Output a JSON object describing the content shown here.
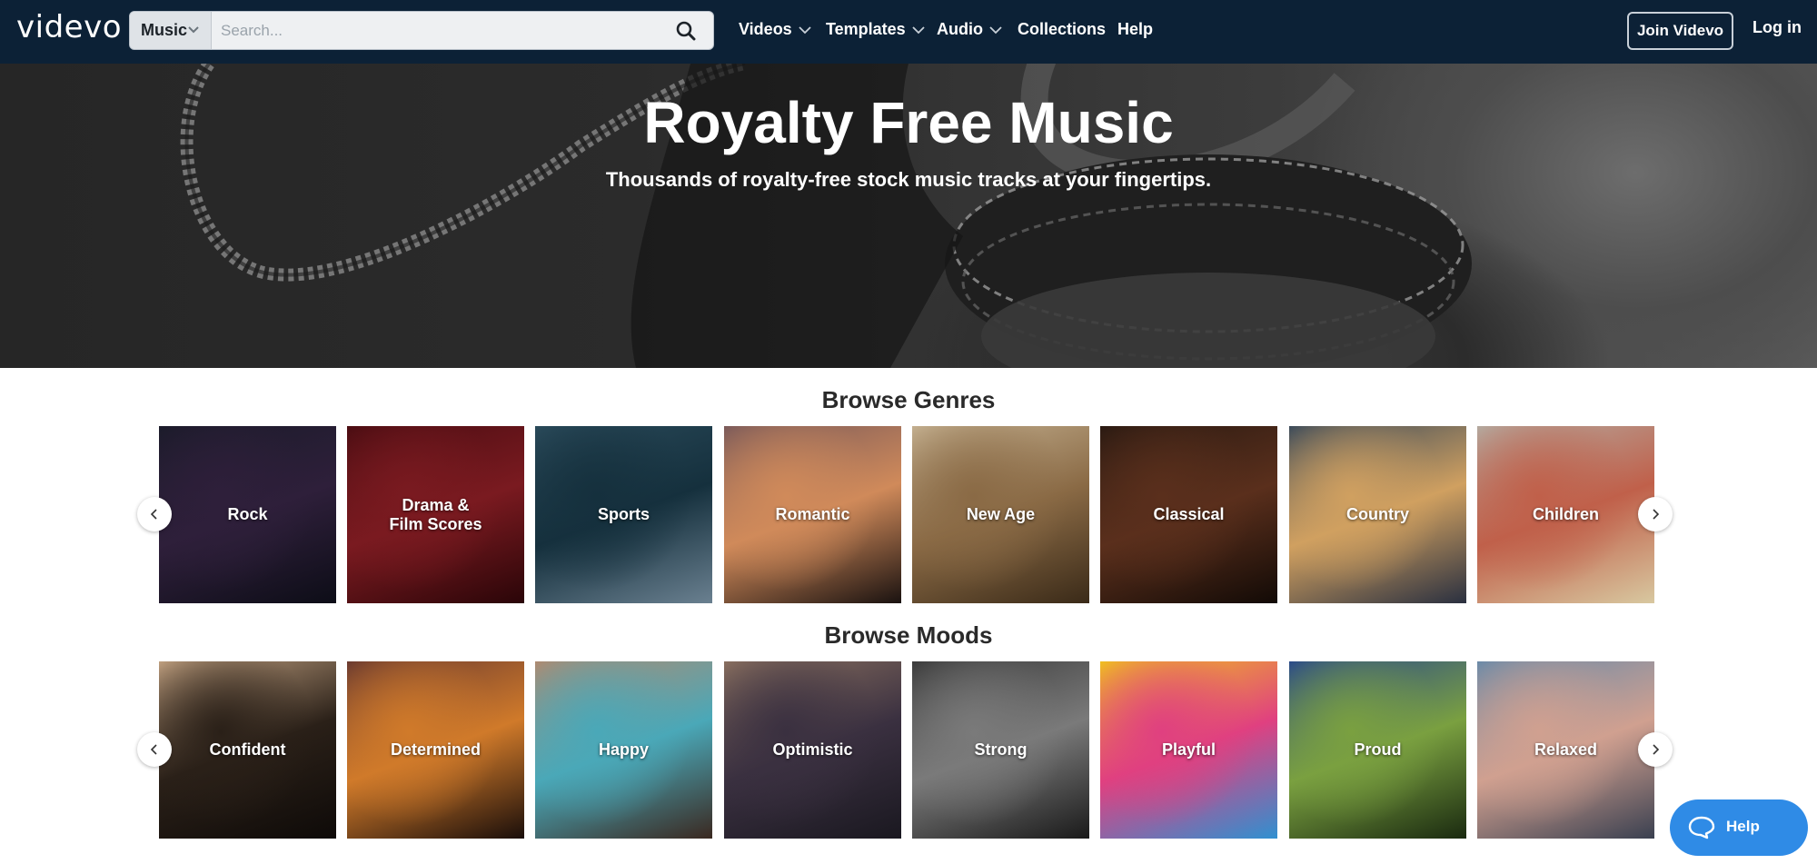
{
  "nav": {
    "logo": "videvo",
    "search_type": "Music",
    "search_placeholder": "Search...",
    "menu": [
      {
        "label": "Videos",
        "dropdown": true
      },
      {
        "label": "Templates",
        "dropdown": true
      },
      {
        "label": "Audio",
        "dropdown": true
      },
      {
        "label": "Collections",
        "dropdown": false
      },
      {
        "label": "Help",
        "dropdown": false
      }
    ],
    "join_label": "Join Videvo",
    "login_label": "Log in"
  },
  "hero": {
    "title": "Royalty Free Music",
    "subtitle": "Thousands of royalty-free stock music tracks at your fingertips."
  },
  "genres": {
    "title": "Browse Genres",
    "items": [
      {
        "label": "Rock",
        "colors": [
          "#1b1b2a",
          "#2e1f3a",
          "#0d0d17"
        ]
      },
      {
        "label": "Drama &\nFilm Scores",
        "colors": [
          "#4a0d12",
          "#7a1a20",
          "#2a0508"
        ]
      },
      {
        "label": "Sports",
        "colors": [
          "#2a4a5a",
          "#15303d",
          "#6a8090"
        ]
      },
      {
        "label": "Romantic",
        "colors": [
          "#7a5a5a",
          "#d08a5a",
          "#1a1210"
        ]
      },
      {
        "label": "New Age",
        "colors": [
          "#c4b090",
          "#8a6a45",
          "#3a2a18"
        ]
      },
      {
        "label": "Classical",
        "colors": [
          "#2a1a12",
          "#5a2f1c",
          "#120a06"
        ]
      },
      {
        "label": "Country",
        "colors": [
          "#3a4a5a",
          "#d0a060",
          "#2a3040"
        ]
      },
      {
        "label": "Children",
        "colors": [
          "#b4aaa0",
          "#c0604a",
          "#d8c8a0"
        ]
      }
    ]
  },
  "moods": {
    "title": "Browse Moods",
    "items": [
      {
        "label": "Confident",
        "colors": [
          "#c0a080",
          "#2a2018",
          "#0e0a08"
        ]
      },
      {
        "label": "Determined",
        "colors": [
          "#6a3a30",
          "#d07a2a",
          "#1a0e0a"
        ]
      },
      {
        "label": "Happy",
        "colors": [
          "#b08a70",
          "#4aa8b8",
          "#3a2820"
        ]
      },
      {
        "label": "Optimistic",
        "colors": [
          "#8a7060",
          "#3a3040",
          "#1a1820"
        ]
      },
      {
        "label": "Strong",
        "colors": [
          "#3a3a3a",
          "#7a7a7a",
          "#1a1a1a"
        ]
      },
      {
        "label": "Playful",
        "colors": [
          "#f0c020",
          "#e04080",
          "#3090d0"
        ]
      },
      {
        "label": "Proud",
        "colors": [
          "#2a4a8a",
          "#7aa040",
          "#1a2a10"
        ]
      },
      {
        "label": "Relaxed",
        "colors": [
          "#6a8aa8",
          "#d0a090",
          "#3a4050"
        ]
      }
    ]
  },
  "help_widget": {
    "label": "Help"
  }
}
